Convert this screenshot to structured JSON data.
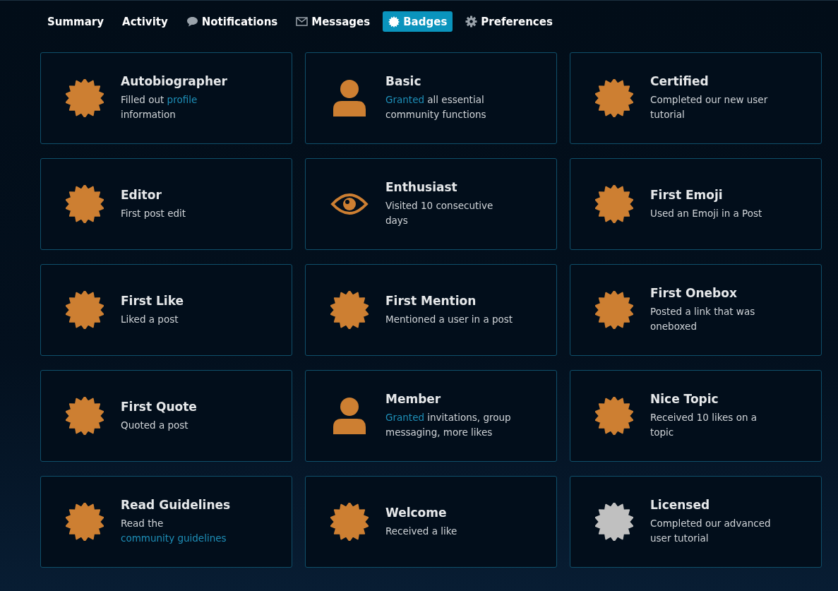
{
  "tabs": [
    {
      "label": "Summary",
      "kind": "plain",
      "selected": false
    },
    {
      "label": "Activity",
      "kind": "plain",
      "selected": false
    },
    {
      "label": "Notifications",
      "kind": "chat",
      "selected": false
    },
    {
      "label": "Messages",
      "kind": "envelope",
      "selected": false
    },
    {
      "label": "Badges",
      "kind": "burst",
      "selected": true
    },
    {
      "label": "Preferences",
      "kind": "gear",
      "selected": false
    }
  ],
  "badges": [
    {
      "title": "Autobiographer",
      "kind": "burst",
      "color": "#cd7f32",
      "description": [
        {
          "text": "Filled out "
        },
        {
          "text": "profile",
          "link": true
        },
        {
          "text": " information"
        }
      ]
    },
    {
      "title": "Basic",
      "kind": "person",
      "color": "#cd7f32",
      "description": [
        {
          "text": "Granted",
          "link": true
        },
        {
          "text": " all essential community functions"
        }
      ]
    },
    {
      "title": "Certified",
      "kind": "burst",
      "color": "#cd7f32",
      "description": [
        {
          "text": "Completed our new user tutorial"
        }
      ]
    },
    {
      "title": "Editor",
      "kind": "burst",
      "color": "#cd7f32",
      "description": [
        {
          "text": "First post edit"
        }
      ]
    },
    {
      "title": "Enthusiast",
      "kind": "eye",
      "color": "#cd7f32",
      "description": [
        {
          "text": "Visited 10 consecutive days"
        }
      ]
    },
    {
      "title": "First Emoji",
      "kind": "burst",
      "color": "#cd7f32",
      "description": [
        {
          "text": "Used an Emoji in a Post"
        }
      ]
    },
    {
      "title": "First Like",
      "kind": "burst",
      "color": "#cd7f32",
      "description": [
        {
          "text": "Liked a post"
        }
      ]
    },
    {
      "title": "First Mention",
      "kind": "burst",
      "color": "#cd7f32",
      "description": [
        {
          "text": "Mentioned a user in a post"
        }
      ]
    },
    {
      "title": "First Onebox",
      "kind": "burst",
      "color": "#cd7f32",
      "description": [
        {
          "text": "Posted a link that was oneboxed"
        }
      ]
    },
    {
      "title": "First Quote",
      "kind": "burst",
      "color": "#cd7f32",
      "description": [
        {
          "text": "Quoted a post"
        }
      ]
    },
    {
      "title": "Member",
      "kind": "person",
      "color": "#cd7f32",
      "description": [
        {
          "text": "Granted",
          "link": true
        },
        {
          "text": " invitations, group messaging, more likes"
        }
      ]
    },
    {
      "title": "Nice Topic",
      "kind": "burst",
      "color": "#cd7f32",
      "description": [
        {
          "text": "Received 10 likes on a topic"
        }
      ]
    },
    {
      "title": "Read Guidelines",
      "kind": "burst",
      "color": "#cd7f32",
      "description": [
        {
          "text": "Read the "
        },
        {
          "text": "community guidelines",
          "link": true
        }
      ]
    },
    {
      "title": "Welcome",
      "kind": "burst",
      "color": "#cd7f32",
      "description": [
        {
          "text": "Received a like"
        }
      ]
    },
    {
      "title": "Licensed",
      "kind": "burst",
      "color": "#c0c0c0",
      "description": [
        {
          "text": "Completed our advanced user tutorial"
        }
      ]
    }
  ]
}
